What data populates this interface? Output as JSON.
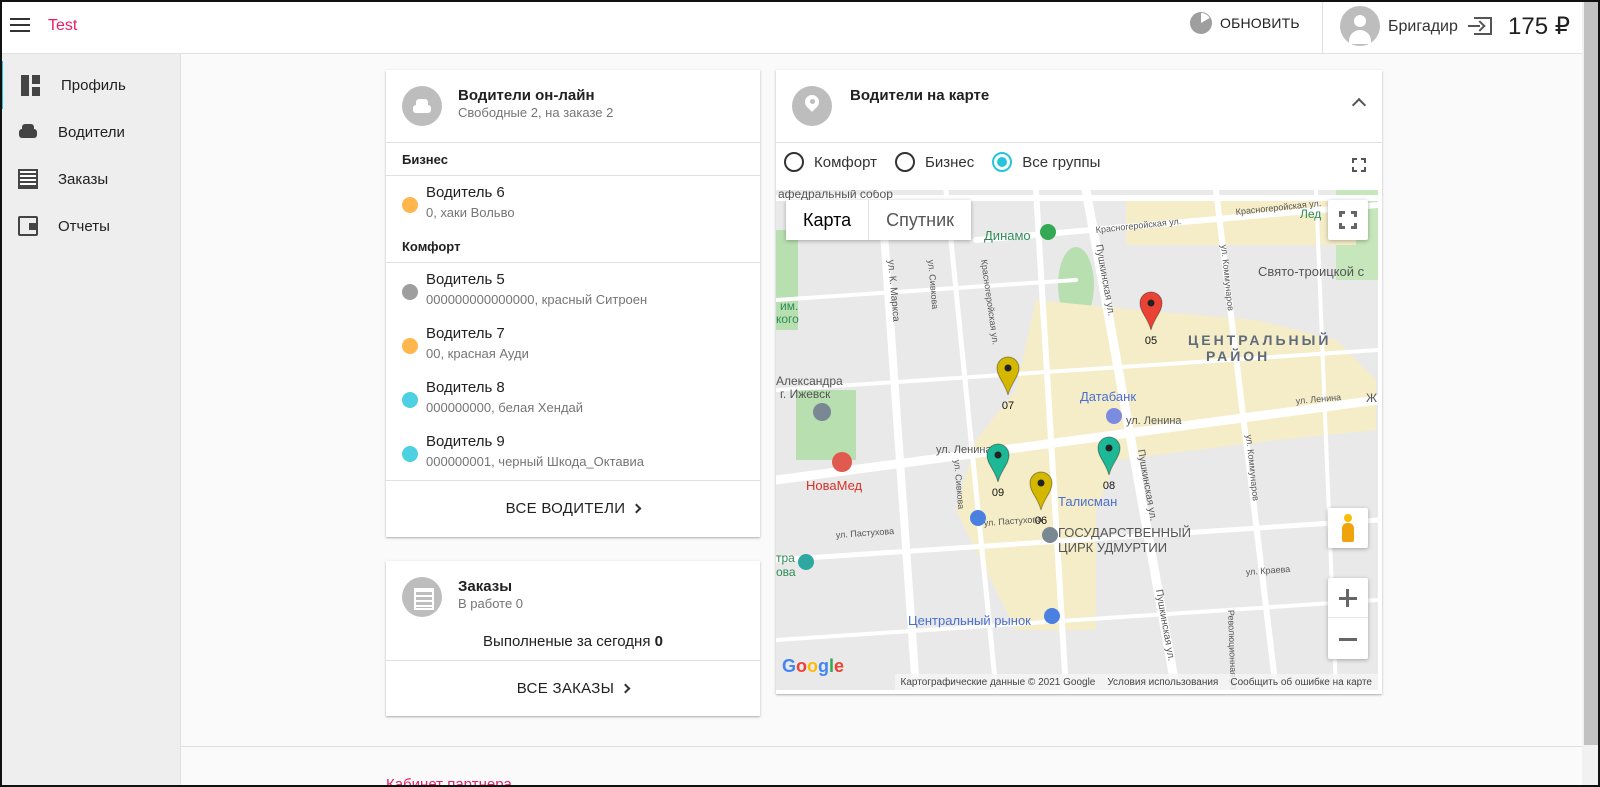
{
  "app": {
    "title": "Test"
  },
  "header": {
    "refresh_label": "ОБНОВИТЬ",
    "user_name": "Бригадир",
    "balance": "175 ₽"
  },
  "sidebar": {
    "items": [
      {
        "label": "Профиль",
        "icon": "dashboard-icon",
        "active": true
      },
      {
        "label": "Водители",
        "icon": "car-icon"
      },
      {
        "label": "Заказы",
        "icon": "list-icon"
      },
      {
        "label": "Отчеты",
        "icon": "wallet-icon"
      }
    ]
  },
  "drivers_card": {
    "title": "Водители он-лайн",
    "subtitle": "Свободные 2, на заказе 2",
    "groups": [
      {
        "name": "Бизнес",
        "drivers": [
          {
            "name": "Водитель 6",
            "info": "0, хаки Вольво",
            "status_color": "#ffb74d"
          }
        ]
      },
      {
        "name": "Комфорт",
        "drivers": [
          {
            "name": "Водитель 5",
            "info": "000000000000000, красный Ситроен",
            "status_color": "#9e9e9e"
          },
          {
            "name": "Водитель 7",
            "info": "00, красная Ауди",
            "status_color": "#ffb74d"
          },
          {
            "name": "Водитель 8",
            "info": "000000000, белая Хендай",
            "status_color": "#4dd0e1"
          },
          {
            "name": "Водитель 9",
            "info": "000000001, черный Шкода_Октавиа",
            "status_color": "#4dd0e1"
          }
        ]
      }
    ],
    "all_label": "ВСЕ ВОДИТЕЛИ"
  },
  "orders_card": {
    "title": "Заказы",
    "subtitle": "В работе 0",
    "done_today_label": "Выполненые за сегодня",
    "done_today_value": "0",
    "all_label": "ВСЕ ЗАКАЗЫ"
  },
  "map_card": {
    "title": "Водители на карте",
    "filters": [
      {
        "label": "Комфорт",
        "checked": false
      },
      {
        "label": "Бизнес",
        "checked": false
      },
      {
        "label": "Все группы",
        "checked": true
      }
    ],
    "map_types": [
      "Карта",
      "Спутник"
    ],
    "labels": {
      "district_1": "ЦЕНТРАЛЬНЫЙ",
      "district_2": "РАЙОН",
      "dinamo": "Динамо",
      "databank": "Датабанк",
      "lenina_1": "ул. Ленина",
      "lenina_2": "ул. Ленина",
      "novamed": "НоваМед",
      "talisman": "Талисман",
      "circus_1": "ГОСУДАРСТВЕННЫЙ",
      "circus_2": "ЦИРК УДМУРТИИ",
      "market": "Центральный рынок",
      "cathedral": "Свято-троицкой с",
      "sobor": "афедральный собор",
      "alexandra_1": "Александра",
      "alexandra_2": "г. Ижевск",
      "im_1": "им.",
      "im_2": "кого",
      "led": "Лед",
      "marks": "ул. К. Маркса",
      "pushkin_1": "Пушкинская ул.",
      "pushkin_2": "Пушкинская ул.",
      "pushkin_3": "Пушкинская ул.",
      "pastukhova": "ул. Пастухова",
      "pastukhova_2": "ул. Пастухова",
      "kraeva": "ул. Краева",
      "sivkova": "ул. Сивкова",
      "sivkova_2": "ул. Сивкова",
      "krasnogeroy": "Красногеройская ул.",
      "krasnogeroy_2": "Красногеройская ул.",
      "krasnogeroy_3": "Красногеройская ул.",
      "kommunarov": "ул. Коммунаров",
      "kommunarov_2": "ул. Коммунаров",
      "revol": "Революционная ул.",
      "lenina_3": "ул. Ленина",
      "tra": "тра",
      "ova": "ова",
      "zh": "Ж"
    },
    "markers": [
      {
        "label": "05",
        "color": "#ea4335"
      },
      {
        "label": "07",
        "color": "#d4b800"
      },
      {
        "label": "09",
        "color": "#1db896"
      },
      {
        "label": "08",
        "color": "#1db896"
      },
      {
        "label": "06",
        "color": "#d4b800"
      }
    ],
    "google": [
      "G",
      "o",
      "o",
      "g",
      "l",
      "e"
    ],
    "attribution": [
      "Картографические данные © 2021 Google",
      "Условия использования",
      "Сообщить об ошибке на карте"
    ]
  },
  "footer": {
    "text": "Кабинет партнера"
  }
}
